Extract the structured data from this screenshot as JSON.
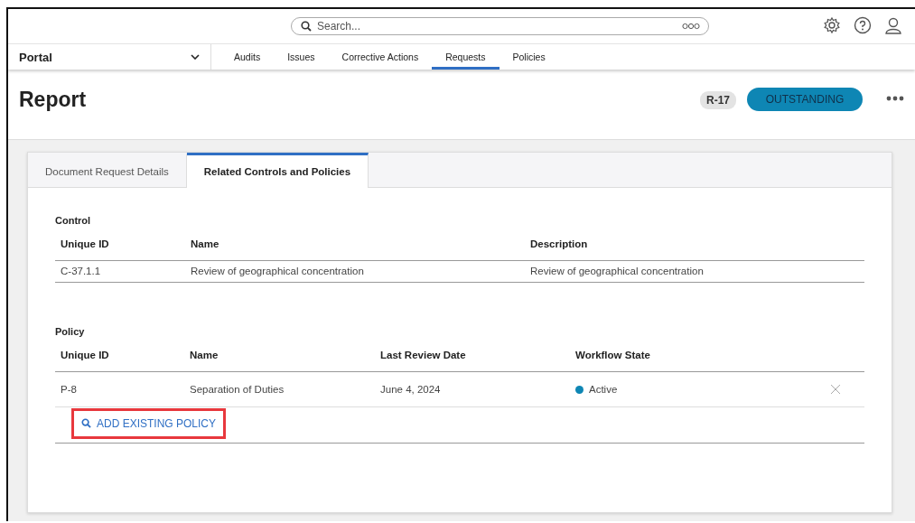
{
  "top_bar": {
    "search": {
      "placeholder": "Search..."
    }
  },
  "nav": {
    "portal": "Portal",
    "tabs": [
      {
        "label": "Audits",
        "selected": false
      },
      {
        "label": "Issues",
        "selected": false
      },
      {
        "label": "Corrective Actions",
        "selected": false
      },
      {
        "label": "Requests",
        "selected": true
      },
      {
        "label": "Policies",
        "selected": false
      }
    ]
  },
  "header": {
    "title": "Report",
    "id_badge": "R-17",
    "status": "OUTSTANDING"
  },
  "card": {
    "tabs": [
      {
        "label": "Document Request Details",
        "selected": false
      },
      {
        "label": "Related Controls and Policies",
        "selected": true
      }
    ],
    "control": {
      "title": "Control",
      "columns": [
        "Unique ID",
        "Name",
        "Description"
      ],
      "rows": [
        [
          "C-37.1.1",
          "Review of geographical concentration",
          "Review of geographical concentration"
        ]
      ]
    },
    "policy": {
      "title": "Policy",
      "columns": [
        "Unique ID",
        "Name",
        "Last Review Date",
        "Workflow State"
      ],
      "rows": [
        {
          "id": "P-8",
          "name": "Separation of Duties",
          "date": "June 4, 2024",
          "state": "Active",
          "color": "#0e86b4"
        }
      ],
      "add_button": {
        "label": "ADD EXISTING POLICY",
        "highlighted": true
      }
    }
  }
}
